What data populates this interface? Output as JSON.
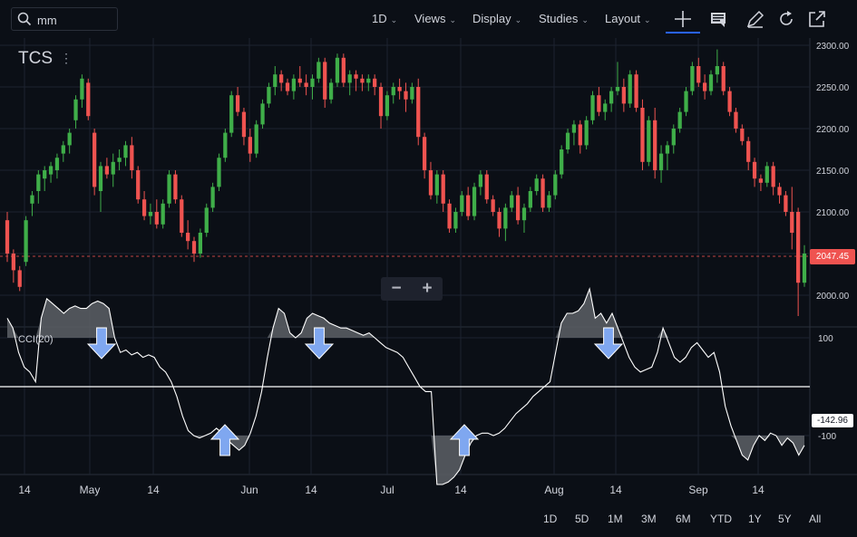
{
  "search": {
    "value": "mm"
  },
  "toolbar": {
    "interval": "1D",
    "views": "Views",
    "display": "Display",
    "studies": "Studies",
    "layout": "Layout",
    "icons": [
      "crosshair-icon",
      "news-icon",
      "pencil-icon",
      "refresh-icon",
      "popout-icon"
    ]
  },
  "chart": {
    "symbol": "TCS",
    "indicator_label": "CCI(20)",
    "last_price_tag": "2047.45",
    "cci_value_tag": "-142.96",
    "price_axis_ticks": [
      "2300.00",
      "2250.00",
      "2200.00",
      "2150.00",
      "2100.00",
      "2050.00",
      "2000.00"
    ],
    "cci_axis_ticks": [
      "100",
      "-100"
    ],
    "time_axis_ticks": [
      "14",
      "May",
      "14",
      "Jun",
      "14",
      "Jul",
      "14",
      "Aug",
      "14",
      "Sep",
      "14"
    ],
    "zoom_out": "−",
    "zoom_in": "+"
  },
  "colors": {
    "up": "#26a69a",
    "up_green": "#3fae49",
    "down": "#ef5350",
    "bg": "#0b0f16",
    "grid": "#1c2330",
    "arrow": "#7fa7f0"
  },
  "chart_data": {
    "type": "candlestick",
    "symbol": "TCS",
    "ylim": [
      1975,
      2310
    ],
    "dates_visible": "mid-April to late September",
    "candles": [
      [
        2090,
        2100,
        2040,
        2050
      ],
      [
        2050,
        2055,
        2015,
        2030
      ],
      [
        2030,
        2035,
        2005,
        2010
      ],
      [
        2040,
        2095,
        2035,
        2090
      ],
      [
        2110,
        2125,
        2095,
        2120
      ],
      [
        2125,
        2150,
        2110,
        2145
      ],
      [
        2140,
        2155,
        2125,
        2150
      ],
      [
        2145,
        2160,
        2135,
        2155
      ],
      [
        2150,
        2170,
        2140,
        2165
      ],
      [
        2170,
        2185,
        2160,
        2180
      ],
      [
        2180,
        2200,
        2170,
        2195
      ],
      [
        2210,
        2240,
        2200,
        2235
      ],
      [
        2235,
        2265,
        2225,
        2260
      ],
      [
        2255,
        2260,
        2210,
        2215
      ],
      [
        2195,
        2200,
        2120,
        2130
      ],
      [
        2125,
        2160,
        2100,
        2155
      ],
      [
        2155,
        2165,
        2140,
        2145
      ],
      [
        2145,
        2170,
        2130,
        2160
      ],
      [
        2160,
        2175,
        2150,
        2165
      ],
      [
        2165,
        2185,
        2155,
        2180
      ],
      [
        2180,
        2190,
        2140,
        2150
      ],
      [
        2150,
        2155,
        2110,
        2115
      ],
      [
        2115,
        2125,
        2090,
        2095
      ],
      [
        2095,
        2110,
        2085,
        2100
      ],
      [
        2100,
        2115,
        2080,
        2085
      ],
      [
        2085,
        2115,
        2080,
        2110
      ],
      [
        2110,
        2150,
        2105,
        2145
      ],
      [
        2145,
        2150,
        2110,
        2115
      ],
      [
        2115,
        2120,
        2070,
        2075
      ],
      [
        2075,
        2090,
        2055,
        2065
      ],
      [
        2065,
        2070,
        2040,
        2050
      ],
      [
        2050,
        2080,
        2045,
        2075
      ],
      [
        2075,
        2110,
        2070,
        2105
      ],
      [
        2105,
        2135,
        2100,
        2130
      ],
      [
        2130,
        2170,
        2125,
        2165
      ],
      [
        2165,
        2200,
        2160,
        2195
      ],
      [
        2195,
        2245,
        2190,
        2240
      ],
      [
        2240,
        2250,
        2215,
        2220
      ],
      [
        2220,
        2225,
        2180,
        2190
      ],
      [
        2190,
        2200,
        2160,
        2170
      ],
      [
        2170,
        2210,
        2165,
        2205
      ],
      [
        2205,
        2235,
        2200,
        2230
      ],
      [
        2230,
        2255,
        2225,
        2250
      ],
      [
        2250,
        2275,
        2240,
        2265
      ],
      [
        2265,
        2270,
        2245,
        2255
      ],
      [
        2255,
        2260,
        2240,
        2245
      ],
      [
        2245,
        2265,
        2235,
        2260
      ],
      [
        2260,
        2275,
        2250,
        2255
      ],
      [
        2255,
        2265,
        2240,
        2250
      ],
      [
        2250,
        2265,
        2235,
        2260
      ],
      [
        2260,
        2285,
        2255,
        2280
      ],
      [
        2280,
        2285,
        2225,
        2235
      ],
      [
        2235,
        2260,
        2230,
        2255
      ],
      [
        2255,
        2290,
        2250,
        2285
      ],
      [
        2285,
        2290,
        2250,
        2255
      ],
      [
        2255,
        2270,
        2240,
        2265
      ],
      [
        2265,
        2270,
        2245,
        2260
      ],
      [
        2260,
        2265,
        2245,
        2255
      ],
      [
        2255,
        2265,
        2245,
        2260
      ],
      [
        2260,
        2265,
        2240,
        2250
      ],
      [
        2250,
        2255,
        2200,
        2215
      ],
      [
        2215,
        2245,
        2210,
        2240
      ],
      [
        2240,
        2255,
        2230,
        2250
      ],
      [
        2250,
        2260,
        2235,
        2245
      ],
      [
        2245,
        2255,
        2220,
        2235
      ],
      [
        2235,
        2255,
        2230,
        2250
      ],
      [
        2250,
        2260,
        2180,
        2190
      ],
      [
        2190,
        2195,
        2140,
        2150
      ],
      [
        2150,
        2160,
        2115,
        2120
      ],
      [
        2120,
        2150,
        2110,
        2145
      ],
      [
        2145,
        2150,
        2100,
        2110
      ],
      [
        2110,
        2115,
        2075,
        2080
      ],
      [
        2080,
        2105,
        2075,
        2100
      ],
      [
        2100,
        2125,
        2095,
        2120
      ],
      [
        2120,
        2130,
        2090,
        2095
      ],
      [
        2095,
        2135,
        2090,
        2130
      ],
      [
        2130,
        2150,
        2120,
        2145
      ],
      [
        2145,
        2150,
        2110,
        2115
      ],
      [
        2115,
        2120,
        2095,
        2100
      ],
      [
        2100,
        2105,
        2070,
        2080
      ],
      [
        2080,
        2110,
        2065,
        2105
      ],
      [
        2105,
        2125,
        2100,
        2120
      ],
      [
        2120,
        2130,
        2085,
        2090
      ],
      [
        2090,
        2110,
        2075,
        2105
      ],
      [
        2105,
        2130,
        2100,
        2125
      ],
      [
        2125,
        2145,
        2120,
        2140
      ],
      [
        2140,
        2145,
        2100,
        2105
      ],
      [
        2105,
        2125,
        2100,
        2120
      ],
      [
        2120,
        2150,
        2115,
        2145
      ],
      [
        2145,
        2180,
        2140,
        2175
      ],
      [
        2175,
        2200,
        2170,
        2195
      ],
      [
        2195,
        2210,
        2180,
        2205
      ],
      [
        2205,
        2210,
        2170,
        2180
      ],
      [
        2180,
        2215,
        2175,
        2210
      ],
      [
        2210,
        2245,
        2205,
        2240
      ],
      [
        2240,
        2250,
        2215,
        2220
      ],
      [
        2220,
        2235,
        2210,
        2230
      ],
      [
        2230,
        2250,
        2220,
        2245
      ],
      [
        2245,
        2280,
        2240,
        2250
      ],
      [
        2250,
        2260,
        2220,
        2230
      ],
      [
        2230,
        2270,
        2225,
        2265
      ],
      [
        2265,
        2270,
        2220,
        2225
      ],
      [
        2225,
        2235,
        2150,
        2160
      ],
      [
        2160,
        2215,
        2155,
        2210
      ],
      [
        2210,
        2225,
        2140,
        2150
      ],
      [
        2150,
        2180,
        2135,
        2170
      ],
      [
        2170,
        2185,
        2150,
        2180
      ],
      [
        2180,
        2205,
        2170,
        2200
      ],
      [
        2200,
        2225,
        2195,
        2220
      ],
      [
        2220,
        2250,
        2215,
        2245
      ],
      [
        2245,
        2280,
        2240,
        2275
      ],
      [
        2275,
        2285,
        2250,
        2255
      ],
      [
        2255,
        2265,
        2235,
        2245
      ],
      [
        2245,
        2270,
        2240,
        2265
      ],
      [
        2265,
        2295,
        2255,
        2275
      ],
      [
        2275,
        2280,
        2240,
        2245
      ],
      [
        2245,
        2250,
        2215,
        2220
      ],
      [
        2220,
        2225,
        2195,
        2200
      ],
      [
        2200,
        2205,
        2180,
        2185
      ],
      [
        2185,
        2190,
        2150,
        2160
      ],
      [
        2160,
        2165,
        2130,
        2140
      ],
      [
        2140,
        2145,
        2125,
        2135
      ],
      [
        2135,
        2160,
        2130,
        2155
      ],
      [
        2155,
        2160,
        2120,
        2130
      ],
      [
        2130,
        2135,
        2110,
        2120
      ],
      [
        2120,
        2125,
        2095,
        2100
      ],
      [
        2100,
        2130,
        2055,
        2075
      ],
      [
        2100,
        2105,
        1975,
        2015
      ],
      [
        2015,
        2060,
        2010,
        2050
      ]
    ],
    "cci": {
      "label": "CCI(20)",
      "levels": [
        100,
        -100
      ],
      "last": -142.96,
      "values": [
        140,
        120,
        70,
        40,
        30,
        10,
        140,
        180,
        170,
        160,
        150,
        160,
        165,
        160,
        160,
        170,
        175,
        170,
        160,
        100,
        70,
        75,
        65,
        70,
        60,
        65,
        60,
        40,
        30,
        10,
        -20,
        -60,
        -90,
        -100,
        -105,
        -100,
        -95,
        -85,
        -95,
        -110,
        -120,
        -130,
        -120,
        -95,
        -60,
        -10,
        60,
        120,
        160,
        150,
        110,
        100,
        110,
        140,
        150,
        145,
        140,
        130,
        125,
        120,
        120,
        115,
        110,
        105,
        110,
        100,
        90,
        80,
        75,
        70,
        60,
        40,
        20,
        0,
        -10,
        -10,
        -200,
        -200,
        -195,
        -185,
        -170,
        -140,
        -115,
        -100,
        -95,
        -95,
        -100,
        -95,
        -85,
        -70,
        -55,
        -45,
        -35,
        -20,
        -10,
        0,
        10,
        70,
        130,
        150,
        150,
        155,
        170,
        200,
        140,
        150,
        130,
        150,
        120,
        90,
        60,
        40,
        30,
        35,
        40,
        70,
        120,
        90,
        60,
        50,
        60,
        80,
        90,
        75,
        60,
        70,
        30,
        -40,
        -80,
        -110,
        -140,
        -150,
        -120,
        -100,
        -110,
        -95,
        -100,
        -120,
        -105,
        -115,
        -140,
        -120
      ]
    }
  },
  "range_buttons": [
    "1D",
    "5D",
    "1M",
    "3M",
    "6M",
    "YTD",
    "1Y",
    "5Y",
    "All"
  ]
}
